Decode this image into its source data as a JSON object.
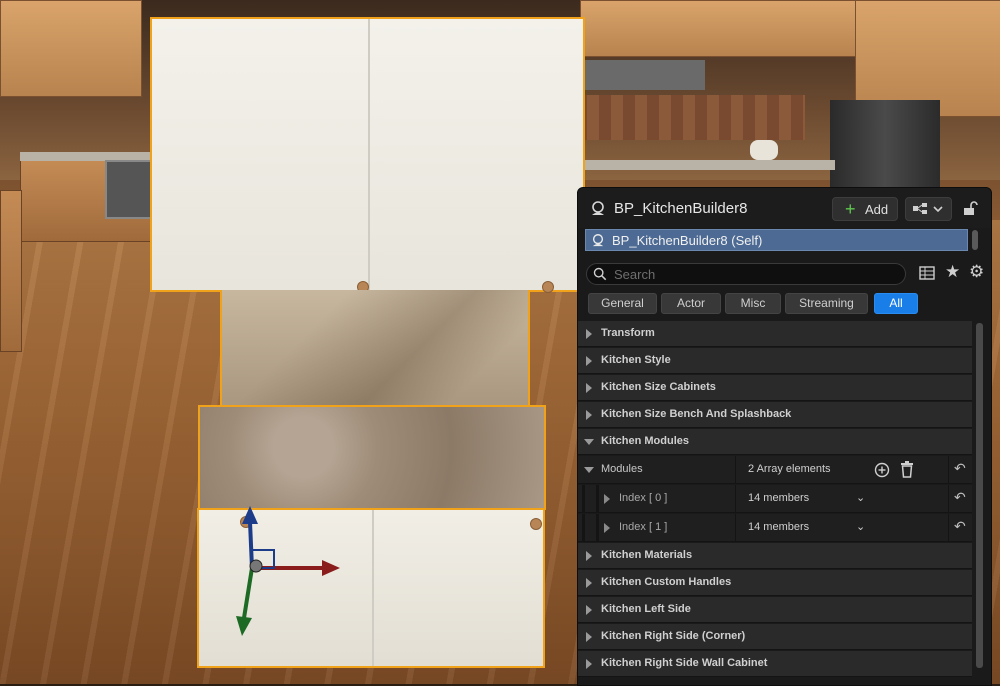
{
  "panel": {
    "title": "BP_KitchenBuilder8",
    "add_label": "Add",
    "component_self": "BP_KitchenBuilder8 (Self)",
    "search_placeholder": "Search",
    "filter_tabs": [
      "General",
      "Actor",
      "Misc",
      "Streaming",
      "All"
    ],
    "active_tab": "All",
    "categories_top": [
      "Transform",
      "Kitchen Style",
      "Kitchen Size Cabinets",
      "Kitchen Size Bench And Splashback",
      "Kitchen Modules"
    ],
    "modules": {
      "label": "Modules",
      "value": "2 Array elements",
      "items": [
        {
          "label": "Index [ 0 ]",
          "value": "14 members"
        },
        {
          "label": "Index [ 1 ]",
          "value": "14 members"
        }
      ]
    },
    "categories_bottom": [
      "Kitchen Materials",
      "Kitchen Custom Handles",
      "Kitchen Left Side",
      "Kitchen Right Side (Corner)",
      "Kitchen Right Side Wall Cabinet"
    ]
  },
  "colors": {
    "selection_outline": "#f0a21b",
    "active_tab": "#1a7ee8",
    "add_plus": "#5ec74e",
    "panel_bg": "#1a1a1a"
  },
  "icons": [
    "actor-icon",
    "plus-icon",
    "blueprint-icon",
    "lock-icon",
    "search-icon",
    "table-icon",
    "star-icon",
    "gear-icon",
    "add-element-icon",
    "delete-icon",
    "revert-icon",
    "chevron-down-icon"
  ]
}
